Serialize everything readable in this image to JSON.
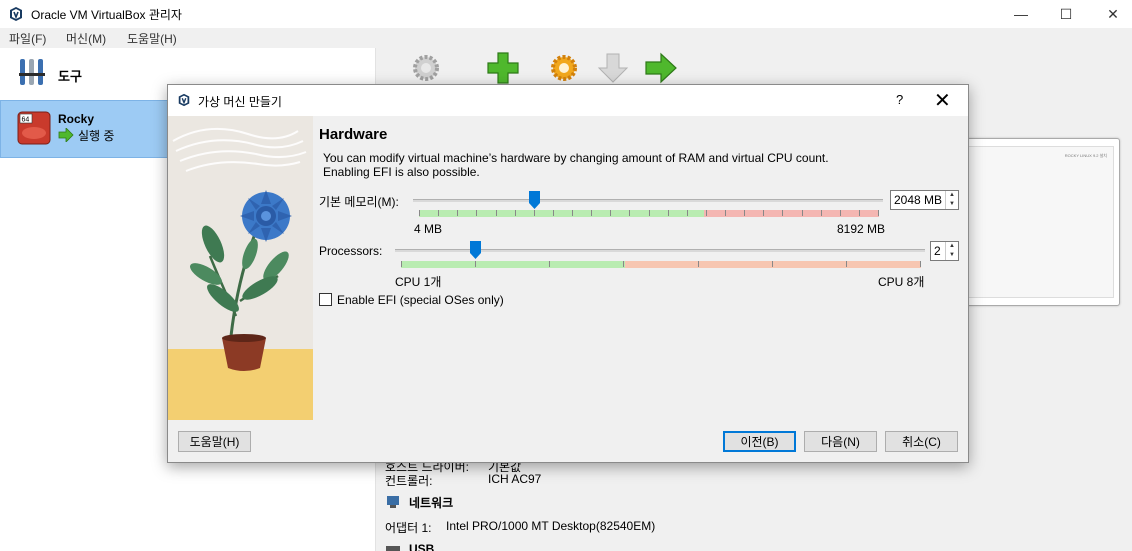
{
  "window": {
    "title": "Oracle VM VirtualBox 관리자",
    "minimize": "—",
    "maximize": "☐",
    "close": "✕"
  },
  "menu": {
    "file": "파일(F)",
    "machine": "머신(M)",
    "help": "도움말(H)"
  },
  "sidebar": {
    "tools_label": "도구",
    "vm": {
      "name": "Rocky",
      "state": "실행 중",
      "badge": "64"
    }
  },
  "preview": {
    "line1": "ROCKY LINUX 9.2 설치"
  },
  "details": {
    "host_driver_label": "호스트 드라이버:",
    "host_driver_value": "기본값",
    "controller_label": "컨트롤러:",
    "controller_value": "ICH AC97",
    "network_header": "네트워크",
    "adapter_label": "어댑터 1:",
    "adapter_value": "Intel PRO/1000 MT Desktop(82540EM)",
    "usb_header": "USB"
  },
  "dialog": {
    "title": "가상 머신 만들기",
    "help_glyph": "?",
    "close_glyph": "✕",
    "heading": "Hardware",
    "description_line1": "You can modify virtual machine’s hardware by changing amount of RAM and virtual CPU count.",
    "description_line2": "Enabling EFI is also possible.",
    "memory": {
      "label": "기본 메모리(M):",
      "value": "2048 MB",
      "min_label": "4 MB",
      "max_label": "8192 MB",
      "value_mb": 2048,
      "max_mb": 8192,
      "safe_fraction": 0.62
    },
    "processors": {
      "label": "Processors:",
      "value": "2",
      "min_label": "CPU 1개",
      "max_label": "CPU 8개",
      "count": 2,
      "max": 8
    },
    "efi": {
      "label": "Enable EFI (special OSes only)",
      "checked": false
    },
    "buttons": {
      "help": "도움말(H)",
      "back": "이전(B)",
      "next": "다음(N)",
      "cancel": "취소(C)"
    }
  },
  "colors": {
    "accent": "#0078d7",
    "selection": "#9dcbf4",
    "scale_green": "#b9ecb1",
    "scale_red": "#f4b6b2",
    "scale_orange": "#f7c6b1"
  }
}
